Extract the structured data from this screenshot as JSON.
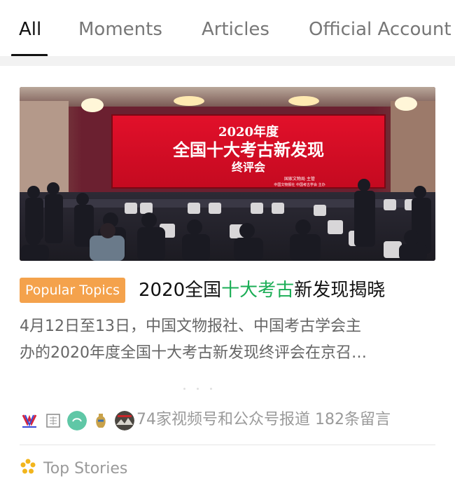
{
  "tabs": [
    {
      "label": "All",
      "active": true
    },
    {
      "label": "Moments",
      "active": false
    },
    {
      "label": "Articles",
      "active": false
    },
    {
      "label": "Official Account",
      "active": false
    }
  ],
  "article": {
    "badge": "Popular Topics",
    "title_pre": "2020全国",
    "title_highlight": "十大考古",
    "title_post": "新发现揭晓",
    "description_line1": "4月12日至13日，中国文物报社、中国考古学会主",
    "description_line2": "办的2020年度全国十大考古新发现终评会在京召…",
    "photo": {
      "screen_line1": "2020年度",
      "screen_line2": "全国十大考古新发现",
      "screen_line3": "终评会",
      "screen_small1": "国家文物局  主管",
      "screen_small2": "中国文物报社    中国考古学会  主办"
    },
    "sources_icons": [
      "video-channel-icon",
      "seal-icon",
      "teal-circle-icon",
      "vase-icon",
      "landscape-icon"
    ],
    "reports_text": "74家视频号和公众号报道 182条留言"
  },
  "footer": {
    "top_stories_label": "Top Stories",
    "icon": "top-stories-flower-icon"
  },
  "colors": {
    "active_tab": "#111111",
    "inactive_tab": "#777777",
    "badge_bg": "#f4a24c",
    "highlight": "#1aad55",
    "muted_text": "#9a9a9a"
  }
}
